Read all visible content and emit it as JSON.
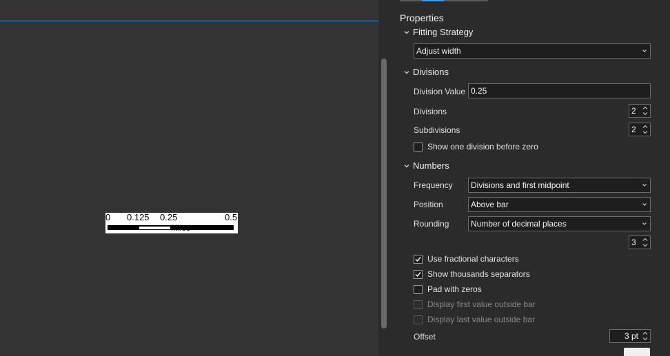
{
  "scalebar": {
    "labels": [
      "0",
      "0.125",
      "0.25",
      "0.5"
    ],
    "units": "Miles"
  },
  "pane": {
    "heading": "Properties",
    "fitting": {
      "title": "Fitting Strategy",
      "value": "Adjust width"
    },
    "divisions": {
      "title": "Divisions",
      "division_value_label": "Division Value",
      "division_value": "0.25",
      "divisions_label": "Divisions",
      "divisions_value": "2",
      "subdivisions_label": "Subdivisions",
      "subdivisions_value": "2",
      "show_before_zero_label": "Show one division before zero",
      "show_before_zero_checked": false
    },
    "numbers": {
      "title": "Numbers",
      "frequency_label": "Frequency",
      "frequency_value": "Divisions and first midpoint",
      "position_label": "Position",
      "position_value": "Above bar",
      "rounding_label": "Rounding",
      "rounding_value": "Number of decimal places",
      "decimal_places": "3",
      "use_fractional_label": "Use fractional characters",
      "use_fractional_checked": true,
      "show_thousands_label": "Show thousands separators",
      "show_thousands_checked": true,
      "pad_zeros_label": "Pad with zeros",
      "pad_zeros_checked": false,
      "first_outside_label": "Display first value outside bar",
      "last_outside_label": "Display last value outside bar",
      "offset_label": "Offset",
      "offset_value": "3 pt"
    }
  }
}
